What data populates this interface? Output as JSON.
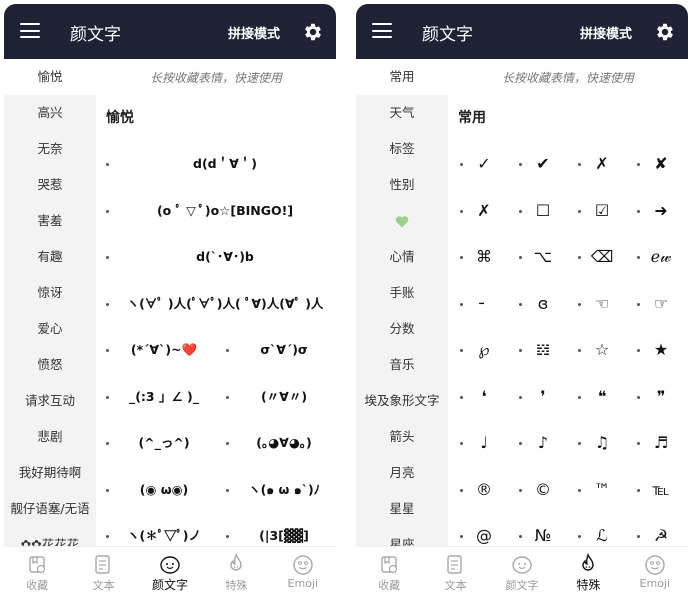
{
  "left": {
    "appbar": {
      "title": "颜文字",
      "mode": "拼接模式"
    },
    "sidebar": [
      {
        "label": "愉悦",
        "active": true
      },
      {
        "label": "高兴"
      },
      {
        "label": "无奈"
      },
      {
        "label": "哭惹"
      },
      {
        "label": "害羞"
      },
      {
        "label": "有趣"
      },
      {
        "label": "惊讶"
      },
      {
        "label": "爱心"
      },
      {
        "label": "愤怒"
      },
      {
        "label": "请求互动"
      },
      {
        "label": "悲剧"
      },
      {
        "label": "我好期待啊"
      },
      {
        "label": "靓仔语塞/无语"
      },
      {
        "label": "✿✿花花花"
      }
    ],
    "hint": "长按收藏表情，快速使用",
    "section_title": "愉悦",
    "rows": [
      [
        "d(d＇∀＇)"
      ],
      [
        "(o ﾟ ▽ ﾟ)o☆[BINGO!]"
      ],
      [
        "d(`･∀･)b"
      ],
      [
        "ヽ(∀ﾟ )人(ﾟ∀ﾟ)人( ﾟ∀)人(∀ﾟ )人"
      ],
      [
        "(*´∀`)~❤️",
        "σ`∀´)σ"
      ],
      [
        "_(:3 」∠ )_",
        "(〃∀〃)"
      ],
      [
        "(^_っ^)",
        "(｡◕∀◕｡)"
      ],
      [
        "(◉ ω◉)",
        "ヽ(๑ ω ๑`)ﾉ"
      ],
      [
        "ヽ(✽ﾟ▽ﾟ)ノ",
        "(|3[▓▓]"
      ]
    ],
    "tabs": [
      {
        "label": "收藏",
        "icon": "collection-icon"
      },
      {
        "label": "文本",
        "icon": "text-icon"
      },
      {
        "label": "颜文字",
        "icon": "kaomoji-icon",
        "active": true
      },
      {
        "label": "特殊",
        "icon": "special-icon"
      },
      {
        "label": "Emoji",
        "icon": "emoji-icon"
      }
    ]
  },
  "right": {
    "appbar": {
      "title": "颜文字",
      "mode": "拼接模式"
    },
    "sidebar": [
      {
        "label": "常用",
        "active": true
      },
      {
        "label": "天气"
      },
      {
        "label": "标签"
      },
      {
        "label": "性别"
      },
      {
        "label": "💚",
        "emoji": true
      },
      {
        "label": "心情"
      },
      {
        "label": "手账"
      },
      {
        "label": "分数"
      },
      {
        "label": "音乐"
      },
      {
        "label": "埃及象形文字"
      },
      {
        "label": "箭头"
      },
      {
        "label": "月亮"
      },
      {
        "label": "星星"
      },
      {
        "label": "星座"
      }
    ],
    "hint": "长按收藏表情，快速使用",
    "section_title": "常用",
    "grid": [
      [
        "✓",
        "✔",
        "✗",
        "✘"
      ],
      [
        "✗",
        "☐",
        "☑",
        "➜"
      ],
      [
        "⌘",
        "⌥",
        "⌫",
        "ℯ𝓌"
      ],
      [
        "╴",
        "ɞ",
        "☜",
        "☞"
      ],
      [
        "℘",
        "𝍌",
        "☆",
        "★"
      ],
      [
        "❛",
        "❜",
        "❝",
        "❞"
      ],
      [
        "♩",
        "♪",
        "♫",
        "♬"
      ],
      [
        "®",
        "©",
        "™",
        "℡"
      ],
      [
        "@",
        "№",
        "ℒ",
        "☭"
      ]
    ],
    "tabs": [
      {
        "label": "收藏",
        "icon": "collection-icon"
      },
      {
        "label": "文本",
        "icon": "text-icon"
      },
      {
        "label": "颜文字",
        "icon": "kaomoji-icon"
      },
      {
        "label": "特殊",
        "icon": "special-icon",
        "active": true
      },
      {
        "label": "Emoji",
        "icon": "emoji-icon"
      }
    ]
  },
  "colors": {
    "appbar_bg": "#1d2334",
    "sidebar_bg": "#f3f3f3",
    "heart_green": "#9bd28a",
    "inactive_tab": "#9a9a9a"
  }
}
